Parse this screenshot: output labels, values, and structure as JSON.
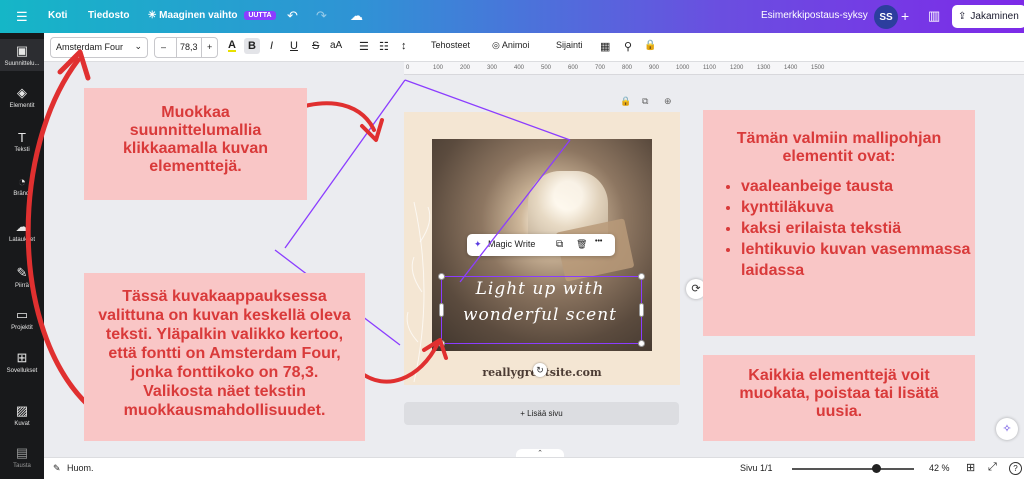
{
  "topbar": {
    "menu_icon": "☰",
    "home": "Koti",
    "file": "Tiedosto",
    "magic_switch": "Maaginen vaihto",
    "magic_switch_icon": "sparkle-icon",
    "new_badge": "UUTTA",
    "undo_icon": "↶",
    "redo_icon": "↷",
    "cloud_icon": "☁",
    "project_title": "Esimerkkipostaus-syksy",
    "avatar_initials": "SS",
    "add_icon": "+",
    "stats_icon": "▥",
    "share_label": "Jakaminen",
    "share_icon": "⇪"
  },
  "sidebar": {
    "items": [
      {
        "label": "Suunnittelu...",
        "icon": "▣"
      },
      {
        "label": "Elementit",
        "icon": "◈"
      },
      {
        "label": "Teksti",
        "icon": "T"
      },
      {
        "label": "Brändi",
        "icon": "◔"
      },
      {
        "label": "Lataukset",
        "icon": "☁"
      },
      {
        "label": "Piirrä",
        "icon": "✎"
      },
      {
        "label": "Projektit",
        "icon": "▭"
      },
      {
        "label": "Sovellukset",
        "icon": "⊞"
      },
      {
        "label": "Kuvat",
        "icon": "▨"
      },
      {
        "label": "Tausta",
        "icon": "▤"
      }
    ]
  },
  "format_toolbar": {
    "font_name": "Amsterdam Four",
    "font_size": "78,3",
    "minus": "–",
    "plus": "+",
    "text_color_icon": "A",
    "bold": "B",
    "italic": "I",
    "underline": "U",
    "strike": "S",
    "case": "aA",
    "align_icon": "☰",
    "list_icon": "☷",
    "spacing_icon": "↕",
    "effects": "Tehosteet",
    "animate": "Animoi",
    "position": "Sijainti",
    "transparency_icon": "▦",
    "copy_style_icon": "⚲",
    "lock_icon": "🔒"
  },
  "ruler": {
    "ticks": [
      "0",
      "100",
      "200",
      "300",
      "400",
      "500",
      "600",
      "700",
      "800",
      "900",
      "1000",
      "1100",
      "1200",
      "1300",
      "1400",
      "1500"
    ]
  },
  "canvas": {
    "page_tools": {
      "lock_icon": "🔒",
      "duplicate_icon": "⧉",
      "add_icon": "⊕"
    },
    "script_line1": "Light up with",
    "script_line2": "wonderful scent",
    "website": "reallygreatsite.com",
    "magic_write": "Magic Write",
    "magic_write_icon": "✦",
    "copy_icon": "⧉",
    "delete_icon": "🗑",
    "more_icon": "•••",
    "rotate_icon": "↻",
    "refresh_icon": "⟳",
    "add_page": "+ Lisää sivu"
  },
  "notes": {
    "top_left": "Muokkaa suunnittelumallia klikkaamalla kuvan elementtejä.",
    "bottom_left": "Tässä kuvakaappauksessa valittuna on kuvan keskellä oleva teksti. Yläpalkin valikko kertoo, että fontti on Amsterdam Four, jonka fonttikoko on 78,3. Valikosta näet tekstin muokkausmahdollisuudet.",
    "right_title": "Tämän valmiin mallipohjan elementit ovat:",
    "right_items": [
      "vaaleanbeige tausta",
      "kynttiläkuva",
      "kaksi erilaista tekstiä",
      "lehtikuvio kuvan vasemmassa laidassa"
    ],
    "bottom_right": "Kaikkia elementtejä voit muokata, poistaa tai lisätä uusia."
  },
  "bottombar": {
    "notes_icon": "✎",
    "notes": "Huom.",
    "page_info": "Sivu 1/1",
    "zoom_level": 0.33,
    "zoom": "42 %",
    "grid_icon": "⊞",
    "fullscreen_icon": "⤢",
    "help_icon": "?",
    "collapse_icon": "⌃",
    "magic_fab_icon": "✧"
  },
  "colors": {
    "note_bg": "#f9c6c6",
    "note_text": "#d93a3a",
    "arrow": "#e03030",
    "selection": "#8b3dff"
  }
}
